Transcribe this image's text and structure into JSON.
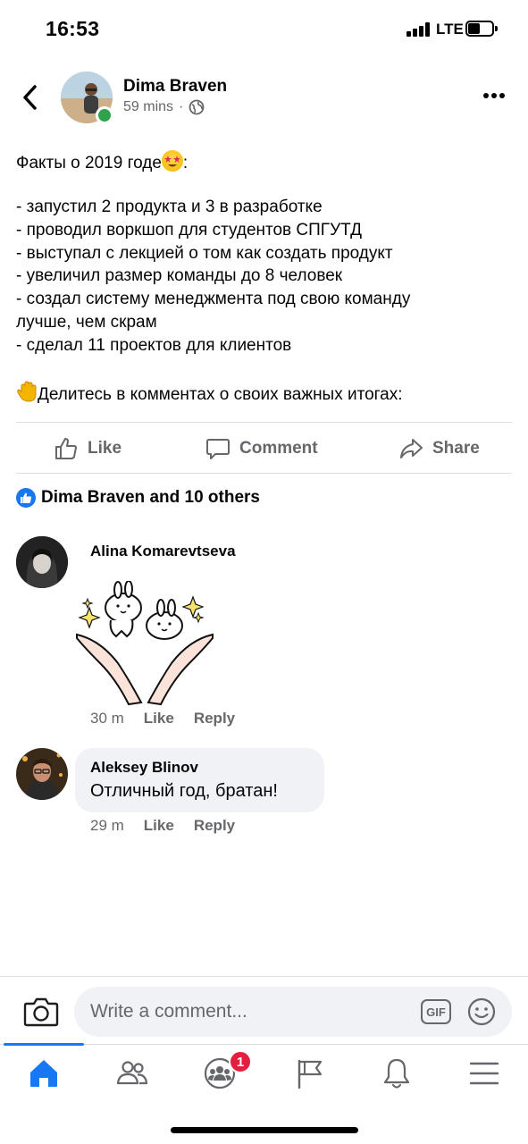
{
  "status_bar": {
    "time": "16:53",
    "network": "LTE"
  },
  "post": {
    "author": "Dima Braven",
    "time": "59 mins",
    "separator": "·",
    "lines": [
      "Факты о 2019 годе",
      "",
      "- запустил 2 продукта и 3 в разработке",
      "- проводил воркшоп для студентов СПГУТД",
      "- выступал с лекцией о том как создать продукт",
      "- увеличил размер команды до 8 человек",
      "- создал систему менеджмента под свою команду",
      "лучше, чем скрам",
      "- сделал 11 проектов для клиентов",
      "",
      "Делитесь в комментах о своих важных итогах:"
    ],
    "title_suffix": ":"
  },
  "actions": {
    "like": "Like",
    "comment": "Comment",
    "share": "Share"
  },
  "reactions": {
    "text": "Dima Braven and 10 others"
  },
  "comments": [
    {
      "author": "Alina Komarevtseva",
      "type": "sticker",
      "time": "30 m",
      "like": "Like",
      "reply": "Reply"
    },
    {
      "author": "Aleksey Blinov",
      "text": "Отличный год, братан!",
      "time": "29 m",
      "like": "Like",
      "reply": "Reply"
    }
  ],
  "composer": {
    "placeholder": "Write a comment...",
    "gif_label": "GIF"
  },
  "tabbar": {
    "tabs": [
      "home-tab",
      "friends-tab",
      "groups-tab",
      "pages-tab",
      "notifications-tab",
      "menu-tab"
    ],
    "groups_badge": "1",
    "active": "home-tab",
    "accent": "#1877f2"
  }
}
